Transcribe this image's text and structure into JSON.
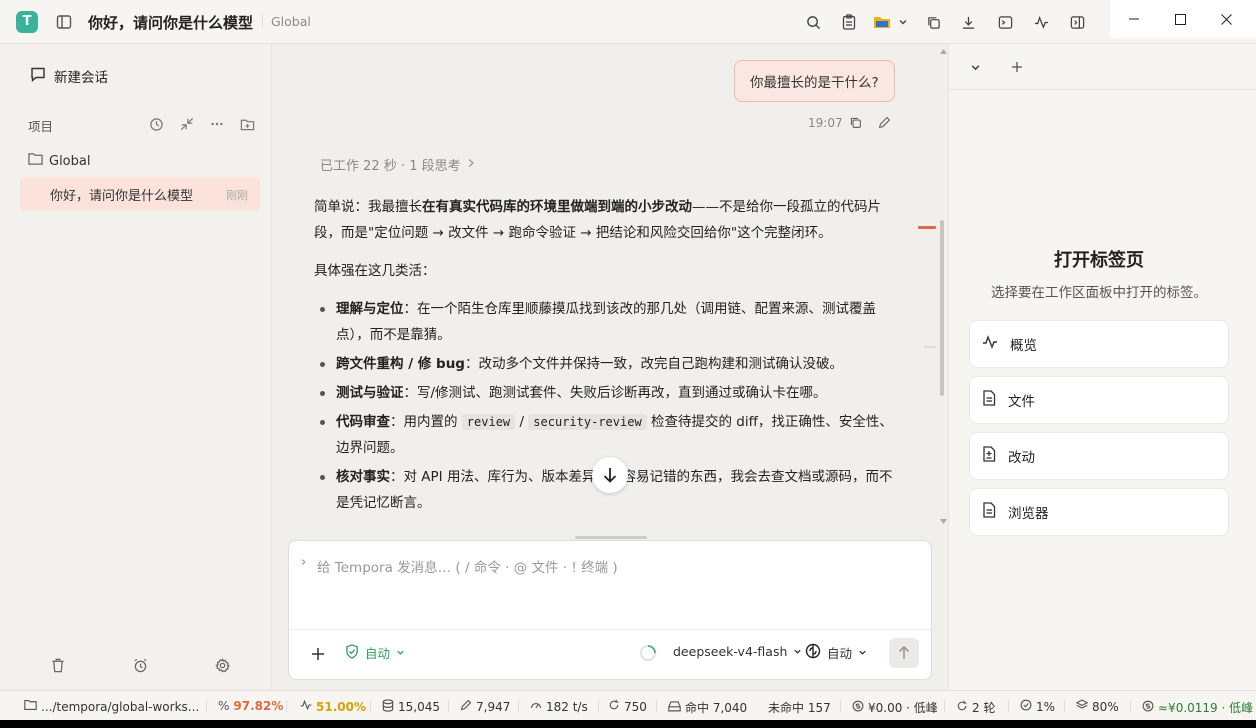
{
  "app": {
    "logo_letter": "T"
  },
  "header": {
    "title": "你好，请问你是什么模型",
    "crumb": "Global"
  },
  "sidebar": {
    "new_chat": "新建会话",
    "projects_label": "项目",
    "folder": "Global",
    "conversations": [
      {
        "title": "你好，请问你是什么模型",
        "time": "刚刚"
      }
    ]
  },
  "chat": {
    "user_message": "你最擅长的是干什么?",
    "user_time": "19:07",
    "worked": "已工作 22 秒 · 1 段思考",
    "intro_prefix": "简单说：我最擅长",
    "intro_bold": "在有真实代码库的环境里做端到端的小步改动",
    "intro_rest": "——不是给你一段孤立的代码片段，而是\"定位问题 → 改文件 → 跑命令验证 → 把结论和风险交回给你\"这个完整闭环。",
    "list_intro": "具体强在这几类活：",
    "items": [
      {
        "bold": "理解与定位",
        "text": "：在一个陌生仓库里顺藤摸瓜找到该改的那几处（调用链、配置来源、测试覆盖点），而不是靠猜。"
      },
      {
        "bold": "跨文件重构 / 修 bug",
        "text": "：改动多个文件并保持一致，改完自己跑构建和测试确认没破。"
      },
      {
        "bold": "测试与验证",
        "text": "：写/修测试、跑测试套件、失败后诊断再改，直到通过或确认卡在哪。"
      },
      {
        "bold": "代码审查",
        "pre": "：用内置的 ",
        "code1": "review",
        "mid": " / ",
        "code2": "security-review",
        "text": " 检查待提交的 diff，找正确性、安全性、边界问题。"
      },
      {
        "bold": "核对事实",
        "text": "：对 API 用法、库行为、版本差异这类容易记错的东西，我会去查文档或源码，而不是凭记忆断言。"
      }
    ]
  },
  "composer": {
    "placeholder": "给 Tempora 发消息… ( / 命令 · @ 文件 · ! 终端 )",
    "mode": "自动",
    "model": "deepseek-v4-flash",
    "reasoning": "自动"
  },
  "right_panel": {
    "title": "打开标签页",
    "subtitle": "选择要在工作区面板中打开的标签。",
    "tabs": [
      {
        "label": "概览",
        "icon": "activity-icon"
      },
      {
        "label": "文件",
        "icon": "file-icon"
      },
      {
        "label": "改动",
        "icon": "diff-icon"
      },
      {
        "label": "浏览器",
        "icon": "browser-icon"
      }
    ]
  },
  "statusbar": {
    "path": ".../tempora/global-works...",
    "pct1": "97.82%",
    "pct2": "51.00%",
    "tokens1": "15,045",
    "tokens2": "7,947",
    "speed": "182 t/s",
    "count": "750",
    "hit": "命中 7,040",
    "miss": "未命中 157",
    "cost1": "¥0.00 · 低峰",
    "rounds": "2 轮",
    "pct3": "1%",
    "pct4": "80%",
    "cost2": "≈¥0.0119 · 低峰",
    "colors": {
      "pct1": "#e2683e",
      "pct2": "#d9a100",
      "cost2": "#2e7d32"
    }
  }
}
